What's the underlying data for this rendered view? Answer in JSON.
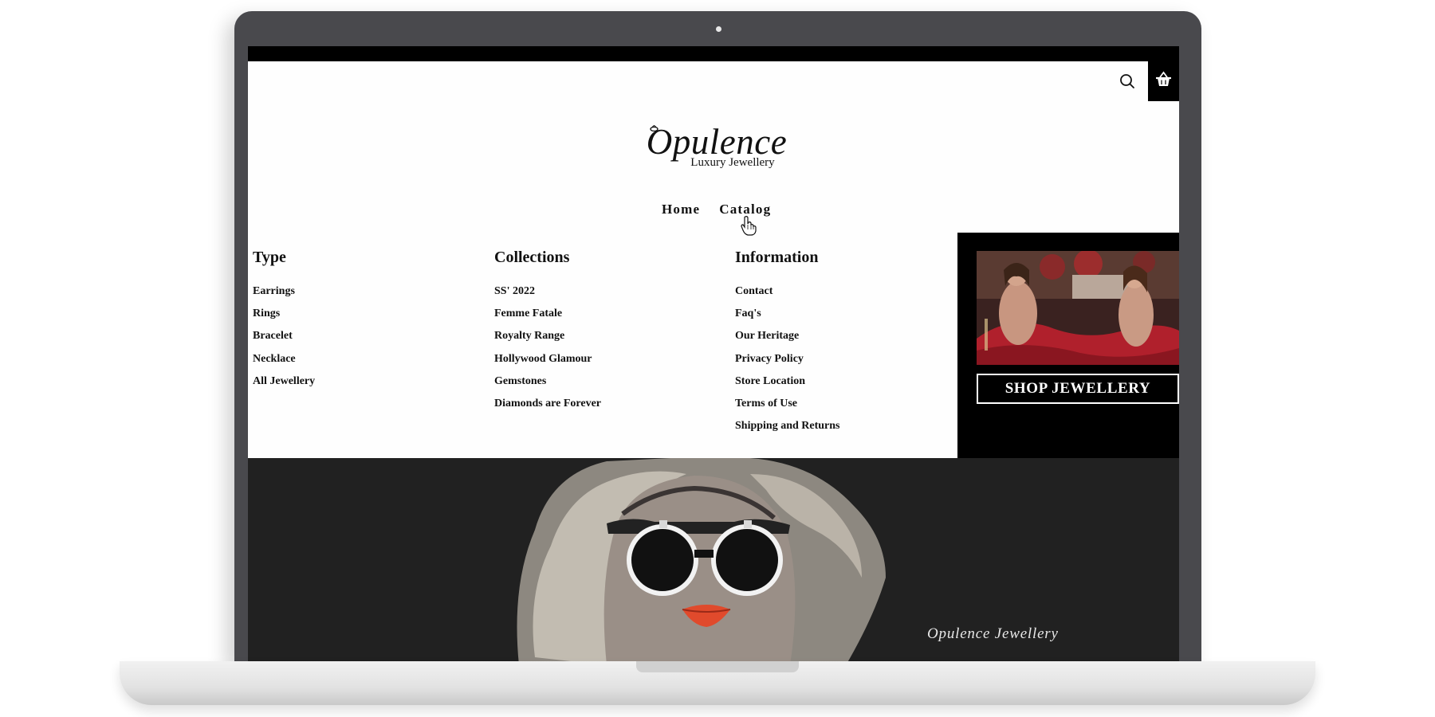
{
  "site": {
    "logo": {
      "title": "Opulence",
      "subtitle": "Luxury Jewellery"
    },
    "icons": {
      "search": "search-icon",
      "cart": "basket-icon"
    },
    "nav": [
      {
        "label": "Home"
      },
      {
        "label": "Catalog"
      }
    ],
    "mega_menu": {
      "columns": [
        {
          "heading": "Type",
          "items": [
            "Earrings",
            "Rings",
            "Bracelet",
            "Necklace",
            "All Jewellery"
          ]
        },
        {
          "heading": "Collections",
          "items": [
            "SS' 2022",
            "Femme Fatale",
            "Royalty Range",
            "Hollywood Glamour",
            "Gemstones",
            "Diamonds are Forever"
          ]
        },
        {
          "heading": "Information",
          "items": [
            "Contact",
            "Faq's",
            "Our Heritage",
            "Privacy Policy",
            "Store Location",
            "Terms of Use",
            "Shipping and Returns"
          ]
        }
      ],
      "promo": {
        "button_label": "SHOP JEWELLERY"
      }
    },
    "hero": {
      "eyebrow": "Opulence Jewellery"
    }
  },
  "colors": {
    "page_bg": "#fefefe",
    "text": "#111111",
    "dark": "#000000",
    "hero_bg": "#212121",
    "lips": "#e04a2c"
  }
}
